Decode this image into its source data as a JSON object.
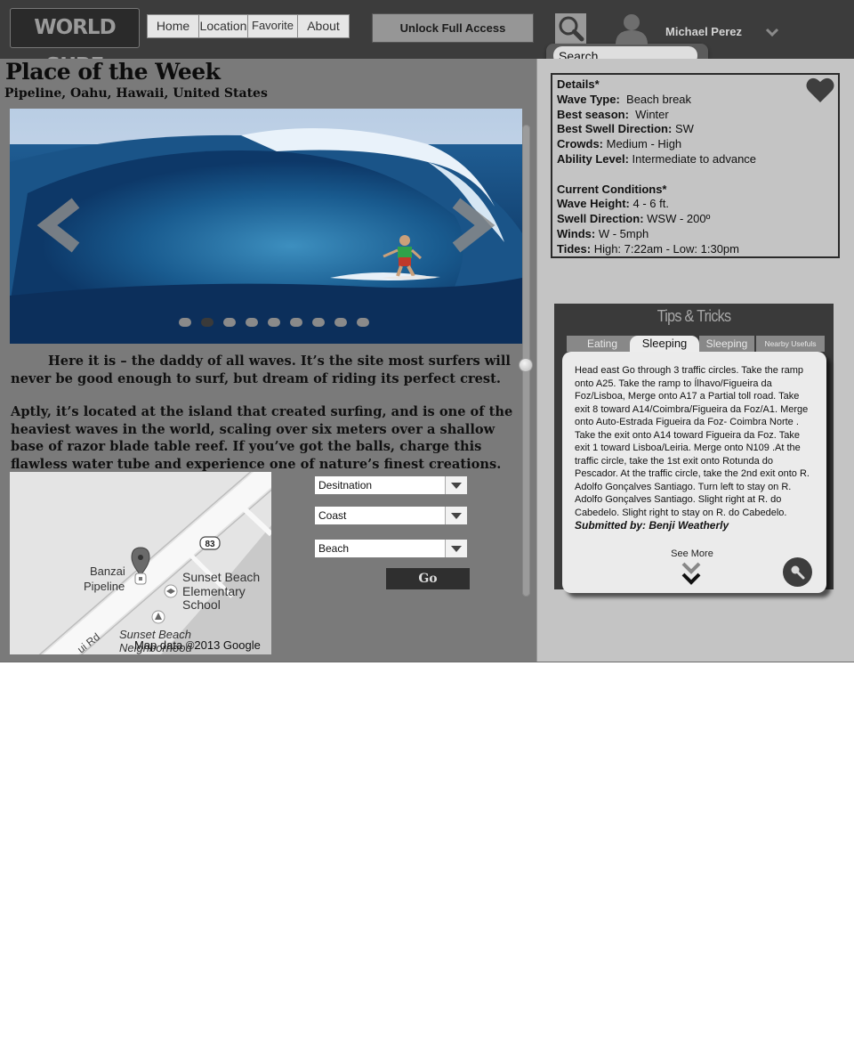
{
  "header": {
    "logo_text": "WORLD SURF",
    "nav": [
      {
        "label": "Home"
      },
      {
        "label": "Location"
      },
      {
        "label": "Favorite"
      },
      {
        "label": "About"
      }
    ],
    "unlock_label": "Unlock Full Access",
    "search_placeholder": "Search . . .",
    "user_name": "Michael Perez"
  },
  "main": {
    "title": "Place of the Week",
    "subtitle": "Pipeline, Oahu, Hawaii, United States",
    "carousel": {
      "slide_count": 9,
      "active_slide": 2
    },
    "paragraph1": "Here it is – the daddy of all waves. It’s the site most surfers will never be good enough to surf, but dream of riding its perfect crest.",
    "paragraph2": "Aptly, it’s located at the island that created surfing, and is one of the heaviest waves in the world, scaling over six meters over a shallow base of razor blade table reef. If you’ve got the balls, charge this flawless water tube and experience one of nature’s finest creations.",
    "map": {
      "place_label_1": "Banzai",
      "place_label_2": "Pipeline",
      "school_label_1": "Sunset Beach",
      "school_label_2": "Elementary",
      "school_label_3": "School",
      "beach_label_1": "Sunset Beach",
      "beach_label_2": "Neighborhood",
      "route_number": "83",
      "road_label": "ui Rd",
      "attribution": "Map data ©2013 Google"
    },
    "selects": {
      "destination": "Desitnation",
      "coast": "Coast",
      "beach": "Beach"
    },
    "go_label": "Go"
  },
  "details": {
    "heading": "Details*",
    "wave_type_label": "Wave Type:",
    "wave_type": "Beach break",
    "best_season_label": "Best season:",
    "best_season": "Winter",
    "best_swell_label": "Best Swell Direction:",
    "best_swell": "SW",
    "crowds_label": "Crowds:",
    "crowds": "Medium - High",
    "ability_label": "Ability Level:",
    "ability": "Intermediate to advance",
    "conditions_heading": "Current Conditions*",
    "wave_height_label": "Wave Height:",
    "wave_height": "4 - 6 ft.",
    "swell_dir_label": "Swell Direction:",
    "swell_dir": "WSW - 200º",
    "winds_label": "Winds:",
    "winds": "W - 5mph",
    "tides_label": "Tides:",
    "tides": "High: 7:22am - Low: 1:30pm"
  },
  "tips": {
    "title": "Tips & Tricks",
    "tabs": [
      {
        "label": "Eating"
      },
      {
        "label": "Sleeping"
      },
      {
        "label": "Sleeping"
      },
      {
        "label": "Nearby Usefuls"
      }
    ],
    "body": "Head east Go through 3 traffic circles. Take the ramp onto A25. Take the ramp to Ílhavo/Figueira da Foz/Lisboa, Merge onto A17 a Partial toll road. Take exit 8 toward A14/Coimbra/Figueira da Foz/A1. Merge onto Auto-Estrada Figueira da Foz- Coimbra Norte . Take the exit onto A14 toward Figueira da Foz. Take exit 1 toward Lisboa/Leiria. Merge onto N109 .At the traffic circle, take the 1st exit onto Rotunda do Pescador. At the traffic circle, take the 2nd exit onto R. Adolfo Gonçalves Santiago. Turn left to stay on R. Adolfo Gonçalves Santiago. Slight right at R. do Cabedelo. Slight right to stay on R. do Cabedelo.",
    "submitted_by": "Submitted by: Benji Weatherly",
    "see_more": "See More"
  },
  "icons": {
    "search": "search-icon",
    "avatar": "user-avatar-icon",
    "user_menu": "chevron-down-icon",
    "prev": "chevron-left-icon",
    "next": "chevron-right-icon",
    "favorite": "heart-icon",
    "map_pin": "map-pin-icon",
    "see_more": "double-chevron-down-icon",
    "zoom": "magnifier-icon"
  },
  "colors": {
    "topbar": "#3c3c3c",
    "left_panel": "#7a7a7a",
    "right_panel": "#c4c4c4",
    "tips_panel": "#3a3a3a"
  }
}
